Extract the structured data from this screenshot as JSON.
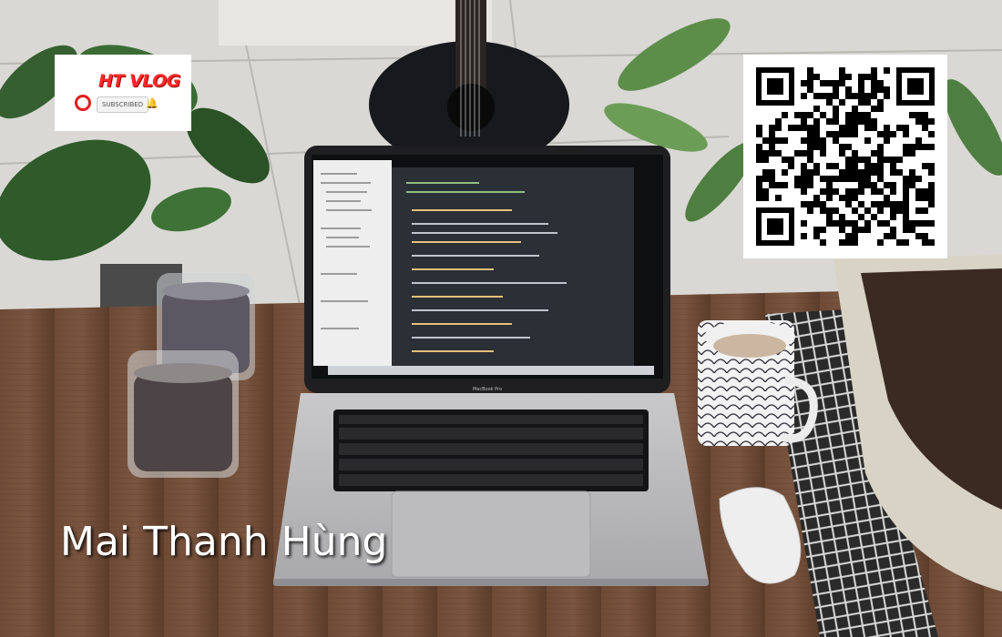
{
  "logo": {
    "title": "HT VLOG",
    "subscribe_label": "SUBSCRIBED",
    "bell_icon": "bell-icon",
    "accent_color": "#ff2a2a"
  },
  "author": {
    "name": "Mai Thanh Hùng"
  },
  "laptop": {
    "brand_label": "MacBook Pro"
  },
  "colors": {
    "text": "#ffffff",
    "table": "#6b4a35"
  }
}
